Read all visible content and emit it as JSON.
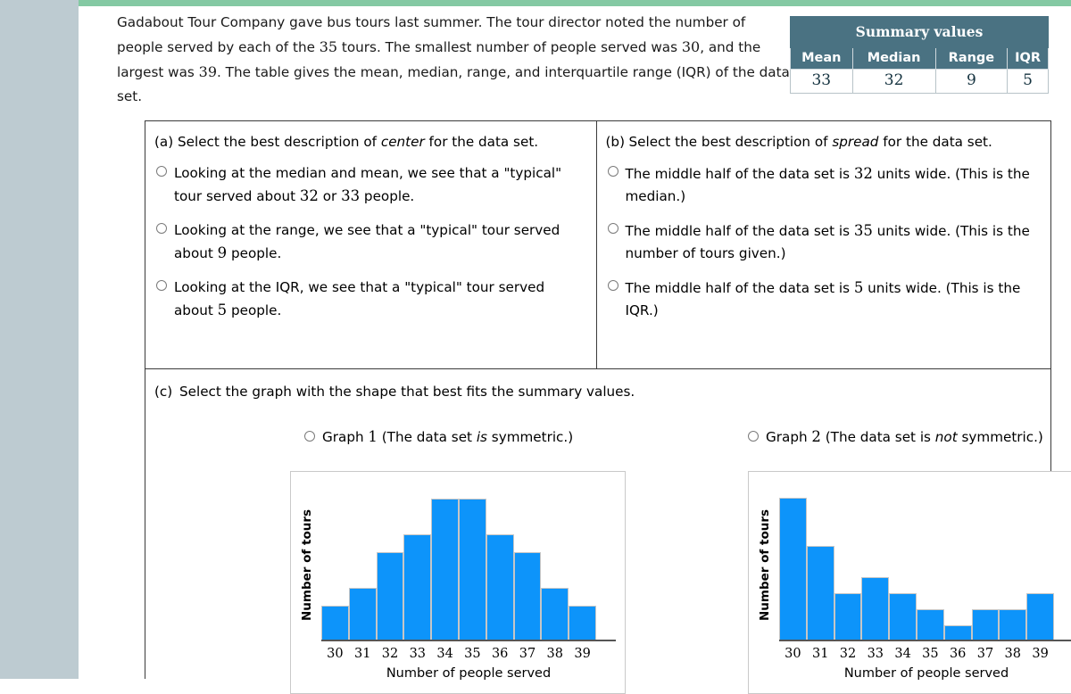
{
  "colors": {
    "rail": "#bdcbd1",
    "top_bar": "#84c9a3",
    "table_header": "#4a7282",
    "bar_fill": "#0d94fa"
  },
  "intro": {
    "text": "Gadabout Tour Company gave bus tours last summer. The tour director noted the number of people served by each of the 35 tours. The smallest number of people served was 30, and the largest was 39. The table gives the mean, median, range, and interquartile range (IQR) of the data set."
  },
  "summary_table": {
    "title": "Summary values",
    "headers": [
      "Mean",
      "Median",
      "Range",
      "IQR"
    ],
    "values": [
      "33",
      "32",
      "9",
      "5"
    ]
  },
  "part_a": {
    "label": "(a)",
    "prompt_before": "Select the best description of ",
    "prompt_em": "center",
    "prompt_after": " for the data set.",
    "options": [
      "Looking at the median and mean, we see that a \"typical\" tour served about 32 or 33 people.",
      "Looking at the range, we see that a \"typical\" tour served about 9 people.",
      "Looking at the IQR, we see that a \"typical\" tour served about 5 people."
    ]
  },
  "part_b": {
    "label": "(b)",
    "prompt_before": "Select the best description of ",
    "prompt_em": "spread",
    "prompt_after": " for the data set.",
    "options": [
      "The middle half of the data set is 32 units wide. (This is the median.)",
      "The middle half of the data set is 35 units wide. (This is the number of tours given.)",
      "The middle half of the data set is 5 units wide. (This is the IQR.)"
    ]
  },
  "part_c": {
    "label": "(c)",
    "prompt": "Select the graph with the shape that best fits the summary values.",
    "graph1_option": {
      "before": "Graph 1 (The data set ",
      "em": "is",
      "after": " symmetric.)"
    },
    "graph2_option": {
      "before": "Graph 2 (The data set is ",
      "em": "not",
      "after": " symmetric.)"
    }
  },
  "chart_data": [
    {
      "type": "bar",
      "title": "Graph 1",
      "categories": [
        "30",
        "31",
        "32",
        "33",
        "34",
        "35",
        "36",
        "37",
        "38",
        "39"
      ],
      "values": [
        2,
        3,
        5,
        6,
        8,
        8,
        6,
        5,
        3,
        2
      ],
      "xlabel": "Number of people served",
      "ylabel": "Number of tours",
      "ylim": [
        0,
        8.5
      ],
      "grid": false,
      "legend": "none",
      "shape": "symmetric"
    },
    {
      "type": "bar",
      "title": "Graph 2",
      "categories": [
        "30",
        "31",
        "32",
        "33",
        "34",
        "35",
        "36",
        "37",
        "38",
        "39"
      ],
      "values": [
        9,
        6,
        3,
        4,
        3,
        2,
        1,
        2,
        2,
        3
      ],
      "xlabel": "Number of people served",
      "ylabel": "Number of tours",
      "ylim": [
        0,
        9.5
      ],
      "grid": false,
      "legend": "none",
      "shape": "not symmetric"
    }
  ]
}
